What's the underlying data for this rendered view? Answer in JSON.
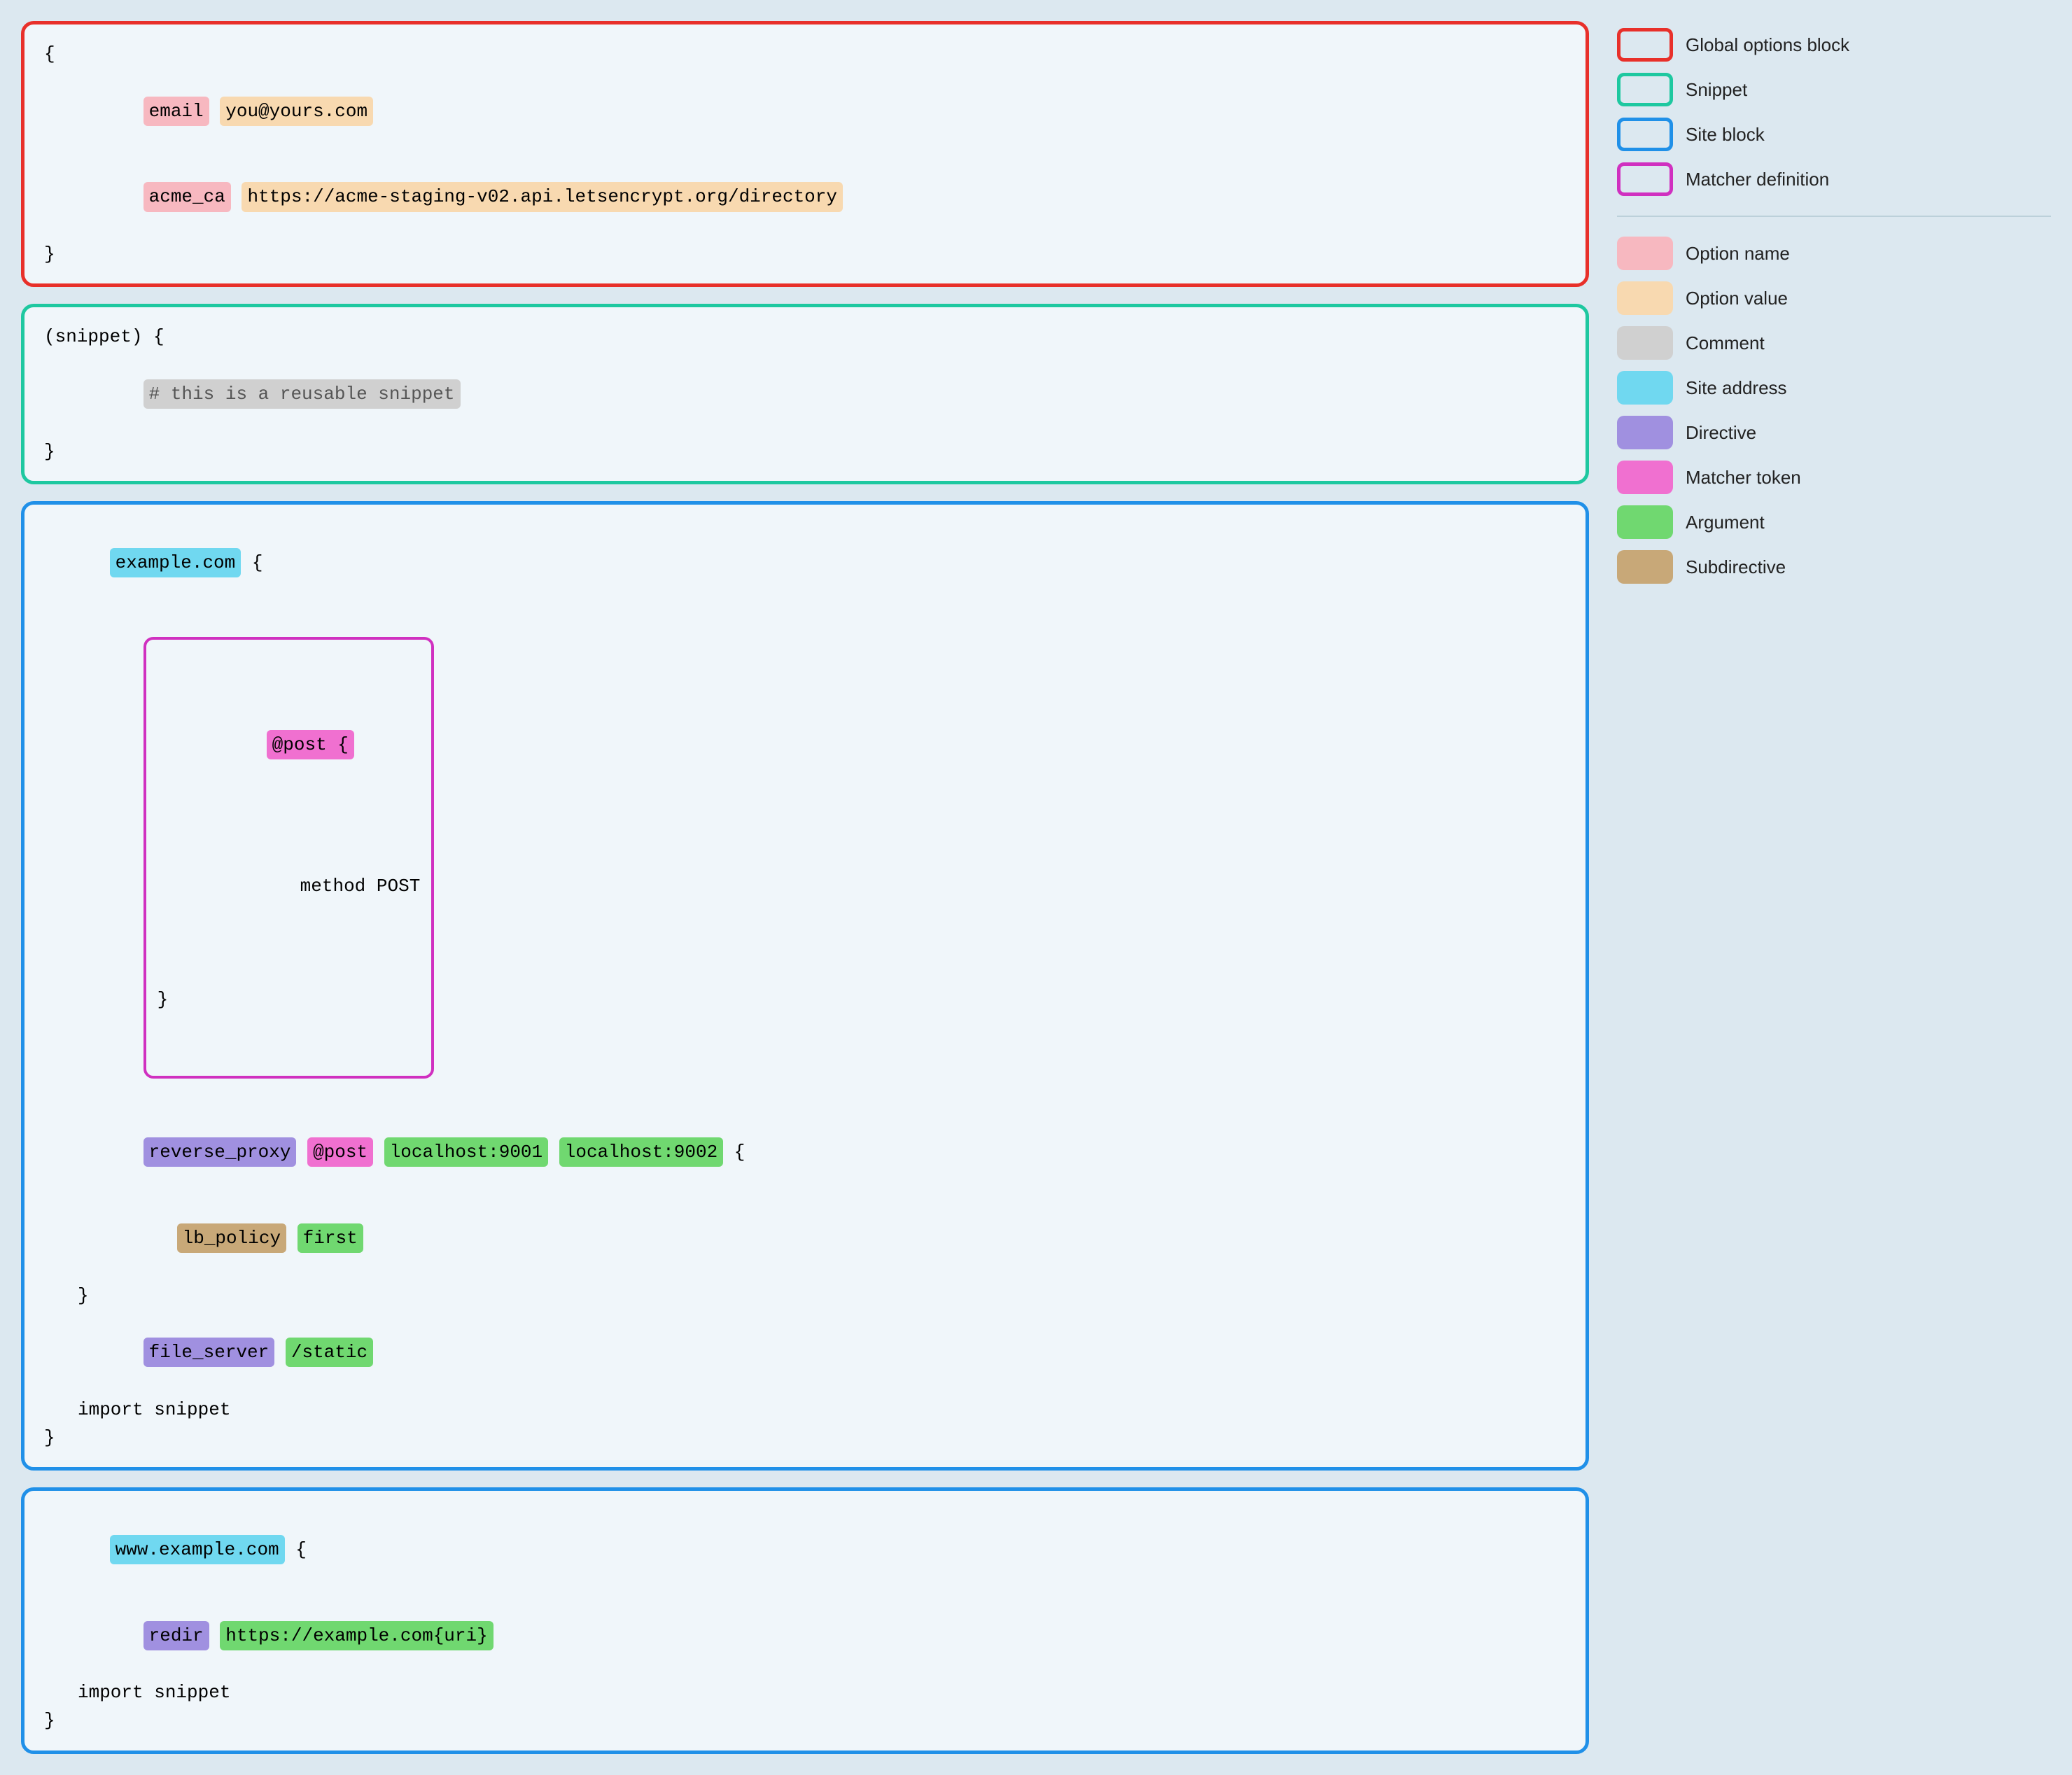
{
  "legend": {
    "border_items": [
      {
        "id": "global-options-block",
        "label": "Global options block",
        "border_color": "#e8302a"
      },
      {
        "id": "snippet",
        "label": "Snippet",
        "border_color": "#1ec8a0"
      },
      {
        "id": "site-block",
        "label": "Site block",
        "border_color": "#2090e8"
      },
      {
        "id": "matcher-definition",
        "label": "Matcher definition",
        "border_color": "#d030c0"
      }
    ],
    "swatch_items": [
      {
        "id": "option-name",
        "label": "Option name",
        "color": "#f7b8c0"
      },
      {
        "id": "option-value",
        "label": "Option value",
        "color": "#f8d9b0"
      },
      {
        "id": "comment",
        "label": "Comment",
        "color": "#d0d0d0"
      },
      {
        "id": "site-address",
        "label": "Site address",
        "color": "#70d8f0"
      },
      {
        "id": "directive",
        "label": "Directive",
        "color": "#a090e0"
      },
      {
        "id": "matcher-token",
        "label": "Matcher token",
        "color": "#f070d0"
      },
      {
        "id": "argument",
        "label": "Argument",
        "color": "#70d870"
      },
      {
        "id": "subdirective",
        "label": "Subdirective",
        "color": "#c8a878"
      }
    ]
  },
  "blocks": {
    "global": {
      "open": "{",
      "option1_name": "email",
      "option1_value": "you@yours.com",
      "option2_name": "acme_ca",
      "option2_value": "https://acme-staging-v02.api.letsencrypt.org/directory",
      "close": "}"
    },
    "snippet": {
      "open": "(snippet) {",
      "comment": "# this is a reusable snippet",
      "close": "}"
    },
    "site1": {
      "address": "example.com",
      "open_suffix": " {",
      "matcher_open": "@post {",
      "matcher_directive": "method",
      "matcher_arg": "POST",
      "matcher_close": "}",
      "line1_directive": "reverse_proxy",
      "line1_matcher": "@post",
      "line1_arg1": "localhost:9001",
      "line1_arg2": "localhost:9002",
      "line1_suffix": " {",
      "line2_subdirective": "lb_policy",
      "line2_arg": "first",
      "line2_close": "}",
      "line3_directive": "file_server",
      "line3_arg": "/static",
      "line4": "import snippet",
      "close": "}"
    },
    "site2": {
      "address": "www.example.com",
      "open_suffix": " {",
      "line1_directive": "redir",
      "line1_arg": "https://example.com{uri}",
      "line2": "import snippet",
      "close": "}"
    }
  }
}
